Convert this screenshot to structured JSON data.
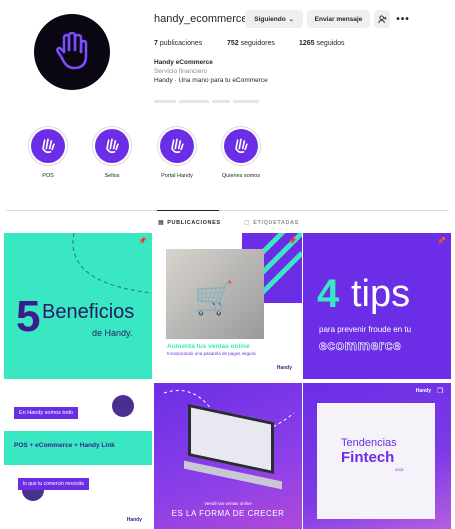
{
  "profile": {
    "username": "handy_ecommerce",
    "following_button": "Siguiendo",
    "message_button": "Enviar mensaje",
    "stats": {
      "posts_count": "7",
      "posts_label": "publicaciones",
      "followers_count": "752",
      "followers_label": "seguidores",
      "following_count": "1265",
      "following_label": "seguidos"
    },
    "bio": {
      "name": "Handy eCommerce",
      "category": "Servicio financiero",
      "text": "Handy · Una mano para tu eCommerce"
    }
  },
  "highlights": [
    {
      "label": "POS"
    },
    {
      "label": "Sellos"
    },
    {
      "label": "Portal Handy"
    },
    {
      "label": "Quienes somos"
    }
  ],
  "tabs": {
    "posts": "PUBLICACIONES",
    "tagged": "ETIQUETADAS"
  },
  "posts": {
    "p1": {
      "number": "5",
      "word": "Beneficios",
      "sub": "de Handy."
    },
    "p2": {
      "headline": "Aumentá tus ventas online",
      "sub": "Incorporando una pasarela de pagos segura",
      "brand": "Handy"
    },
    "p3": {
      "number": "4",
      "word": "tips",
      "line1": "para prevenir froude en tu",
      "line2": "ecommerce"
    },
    "p4": {
      "pill1": "En Handy somos todo",
      "main": "POS + eCommerce + Handy Link",
      "pill2": "lo que tu comercio necesita",
      "brand": "Handy"
    },
    "p5": {
      "cap1": "Vendé las ventas online",
      "cap2": "ES LA FORMA DE CRECER"
    },
    "p6": {
      "brand": "Handy",
      "line1": "Tendencias",
      "line2": "Fintech",
      "year": "2021"
    }
  },
  "colors": {
    "accent": "#6b2ee6",
    "mint": "#39e8c2",
    "dark": "#3a1d8c"
  }
}
